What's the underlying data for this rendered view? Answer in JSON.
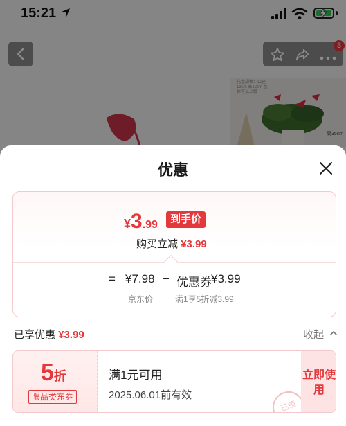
{
  "status_bar": {
    "time": "15:21"
  },
  "background": {
    "badge_count": "3",
    "thumb_text": "花盆规格：口径13cm 高12cm 盆体可以上釉",
    "thumb_size": "高35cm"
  },
  "sheet": {
    "title": "优惠",
    "price": {
      "currency": "¥",
      "integer": "3",
      "decimal": ".99",
      "tag": "到手价",
      "buy_discount_label": "购买立减",
      "buy_discount_value": "¥3.99"
    },
    "formula": {
      "equals": "=",
      "base_price": "¥7.98",
      "minus": "−",
      "coupon_label": "优惠券",
      "coupon_value": "¥3.99",
      "base_price_caption": "京东价",
      "coupon_caption": "满1享5折减3.99"
    },
    "enjoyed": {
      "label": "已享优惠",
      "value": "¥3.99"
    },
    "collapse_label": "收起",
    "coupon": {
      "discount_number": "5",
      "discount_unit": "折",
      "scope_tag": "限品类东券",
      "condition": "满1元可用",
      "expiry": "2025.06.01前有效",
      "use_button": "立即使用",
      "stamp_text": "已领"
    }
  },
  "colors": {
    "accent": "#e4393c",
    "card_border": "#f3c9cb",
    "dim_overlay": "rgba(0,0,0,0.45)"
  },
  "icons": [
    "location-arrow-icon",
    "signal-icon",
    "wifi-icon",
    "battery-icon",
    "back-icon",
    "star-icon",
    "share-icon",
    "more-icon",
    "close-icon",
    "chevron-up-icon"
  ]
}
